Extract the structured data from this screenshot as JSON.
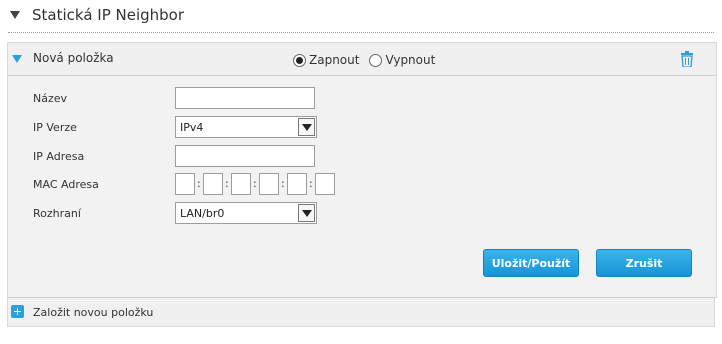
{
  "section": {
    "title": "Statická IP Neighbor"
  },
  "panel": {
    "title": "Nová položka",
    "radio": {
      "on_label": "Zapnout",
      "off_label": "Vypnout",
      "selected": "Zapnout"
    }
  },
  "form": {
    "name_label": "Název",
    "name_value": "",
    "ipver_label": "IP Verze",
    "ipver_value": "IPv4",
    "ip_label": "IP Adresa",
    "ip_value": "",
    "mac_label": "MAC Adresa",
    "mac_separator": ":",
    "iface_label": "Rozhraní",
    "iface_value": "LAN/br0"
  },
  "actions": {
    "save_label": "Uložit/Použít",
    "cancel_label": "Zrušit"
  },
  "footer": {
    "add_label": "Založit novou položku"
  },
  "icons": {
    "collapse": "chevron-down-icon",
    "delete": "trash-icon",
    "add": "plus-icon"
  },
  "colors": {
    "accent": "#2a9fd8",
    "button": "#1b9ad9"
  }
}
